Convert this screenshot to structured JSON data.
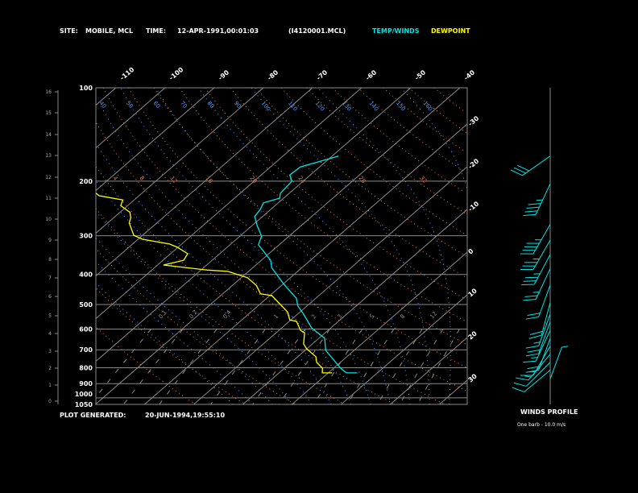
{
  "header": {
    "site_label": "SITE:",
    "site_value": "MOBILE, MCL",
    "time_label": "TIME:",
    "time_value": "12-APR-1991,00:01:03",
    "file": "(I4120001.MCL)",
    "legend_temp": "TEMP/WINDS",
    "legend_dew": "DEWPOINT"
  },
  "footer": {
    "generated_label": "PLOT GENERATED:",
    "generated_value": "20-JUN-1994,19:55:10",
    "winds_title": "WINDS PROFILE",
    "barb_note": "One barb - 10.0 m/s"
  },
  "colors": {
    "background": "#000000",
    "temperature": "#00e5e5",
    "dewpoint": "#ffff00",
    "isotherm": "#8a8a8a",
    "dry_adiabat": "#e07840",
    "moist_adiabat": "#4a9cff",
    "mixing_ratio": "#8a8a8a",
    "text": "#ffffff"
  },
  "chart_data": {
    "type": "skew-t",
    "pressure_axis": {
      "unit": "mb",
      "scale": "log",
      "range": [
        100,
        1050
      ],
      "ticks": [
        100,
        200,
        300,
        400,
        500,
        600,
        700,
        800,
        900,
        1000,
        1050
      ],
      "tick_labels": [
        "100",
        "200",
        "300",
        "400",
        "500",
        "600",
        "700",
        "800",
        "900",
        "1000",
        "1050"
      ]
    },
    "height_axis": {
      "unit": "km",
      "ticks": [
        "0",
        "1",
        "2",
        "3",
        "4",
        "5",
        "6",
        "7",
        "8",
        "9",
        "10",
        "11",
        "12",
        "13",
        "14",
        "15",
        "16"
      ]
    },
    "isotherm_top_labels": [
      "-110",
      "-100",
      "-90",
      "-80",
      "-70",
      "-60",
      "-50",
      "-40"
    ],
    "isotherm_top_values": [
      -110,
      -100,
      -90,
      -80,
      -70,
      -60,
      -50,
      -40
    ],
    "isotherm_right_labels": [
      "-30",
      "-20",
      "-10",
      "0",
      "10",
      "20",
      "30"
    ],
    "isotherm_right_values": [
      -30,
      -20,
      -10,
      0,
      10,
      20,
      30
    ],
    "theta_labels_top": [
      "40",
      "50",
      "60",
      "70",
      "80",
      "90",
      "100",
      "110",
      "120",
      "130",
      "140",
      "150",
      "160"
    ],
    "orange_labels_200mb": [
      "4",
      "8",
      "12",
      "16",
      "20",
      "24",
      "28",
      "32"
    ],
    "mixing_ratio_labels": [
      "0.1",
      "0.2",
      "0.4",
      "1",
      "2",
      "3",
      "5",
      "8",
      "12"
    ],
    "mixing_ratio_values": [
      0.1,
      0.2,
      0.4,
      1,
      2,
      3,
      5,
      8,
      12
    ],
    "temperature": {
      "name": "TEMP/WINDS",
      "pressure": [
        166,
        180,
        191,
        200,
        219,
        227,
        235,
        247,
        260,
        278,
        301,
        321,
        360,
        380,
        431,
        477,
        506,
        537,
        595,
        643,
        703,
        802,
        831,
        831
      ],
      "temp_c": [
        -48.7,
        -53.9,
        -54.2,
        -52.3,
        -51.8,
        -50.8,
        -53.0,
        -52.1,
        -51.6,
        -49.0,
        -45.6,
        -44.2,
        -38.1,
        -36.2,
        -29.7,
        -24.0,
        -21.8,
        -18.8,
        -13.9,
        -8.8,
        -5.8,
        1.4,
        3.7,
        5.9
      ]
    },
    "dewpoint": {
      "name": "DEWPOINT",
      "pressure": [
        219,
        223,
        230,
        240,
        252,
        262,
        273,
        299,
        308,
        319,
        327,
        343,
        360,
        373,
        387,
        391,
        410,
        435,
        462,
        468,
        528,
        561,
        567,
        606,
        617,
        670,
        694,
        737,
        769,
        802,
        831,
        831
      ],
      "temp_c": [
        -89.3,
        -88.1,
        -82.3,
        -81.4,
        -78.0,
        -76.6,
        -75.6,
        -71.8,
        -69.1,
        -62.5,
        -60.1,
        -56.5,
        -55.8,
        -58.8,
        -48.8,
        -44.2,
        -38.7,
        -35.0,
        -32.3,
        -29.6,
        -22.6,
        -20.2,
        -18.5,
        -15.6,
        -14.2,
        -11.8,
        -10.1,
        -6.3,
        -4.8,
        -2.3,
        -1.2,
        0.8
      ]
    },
    "winds": {
      "unit": "m/s",
      "barb_value": 10,
      "pressure": [
        166,
        204,
        276,
        310,
        345,
        383,
        433,
        493,
        537,
        569,
        606,
        643,
        681,
        723,
        768,
        814,
        870
      ],
      "direction_deg": [
        235,
        205,
        210,
        210,
        208,
        205,
        200,
        195,
        200,
        200,
        205,
        200,
        210,
        220,
        225,
        230,
        20
      ],
      "speed": [
        30,
        45,
        45,
        35,
        35,
        25,
        20,
        20,
        15,
        20,
        15,
        20,
        15,
        15,
        10,
        10,
        5
      ]
    }
  }
}
